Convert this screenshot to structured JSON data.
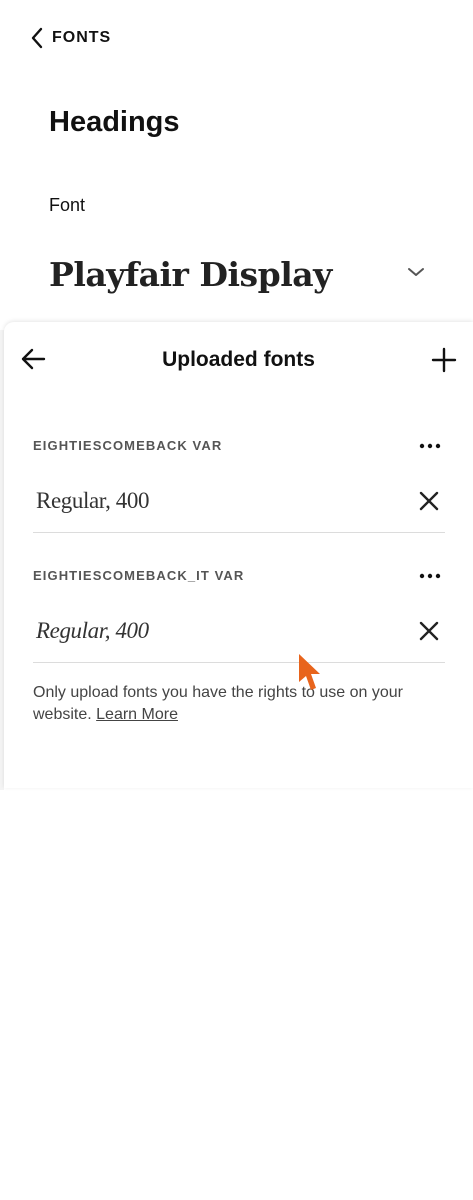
{
  "back_panel": {
    "breadcrumb_label": "FONTS",
    "title": "Headings",
    "font_field_label": "Font",
    "font_selected": "Playfair Display"
  },
  "uploaded_fonts": {
    "title": "Uploaded fonts",
    "families": [
      {
        "name": "EIGHTIESCOMEBACK VAR",
        "variant": "Regular, 400",
        "italic": false
      },
      {
        "name": "EIGHTIESCOMEBACK_IT VAR",
        "variant": "Regular, 400",
        "italic": true
      }
    ],
    "notice_text": "Only upload fonts you have the rights to use on your website. ",
    "learn_more_label": "Learn More"
  },
  "colors": {
    "text": "#111111",
    "muted": "#555555",
    "divider": "#dcdcdc",
    "cursor": "#e8641c"
  },
  "icons": [
    "chevron-left-icon",
    "chevron-down-icon",
    "arrow-left-icon",
    "plus-icon",
    "more-horizontal-icon",
    "close-icon",
    "mouse-pointer-icon"
  ]
}
